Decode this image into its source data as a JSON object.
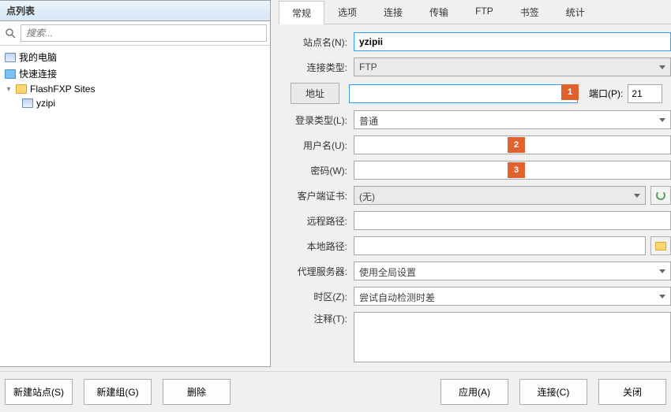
{
  "left": {
    "header": "点列表",
    "search_placeholder": "搜索...",
    "tree": {
      "my_pc": "我的电脑",
      "quick": "快速连接",
      "sites": "FlashFXP Sites",
      "site1": "yzipi"
    }
  },
  "tabs": [
    "常规",
    "选项",
    "连接",
    "传输",
    "FTP",
    "书签",
    "统计"
  ],
  "form": {
    "site_name_label": "站点名(N):",
    "site_name_value": "yzipii",
    "conn_type_label": "连接类型:",
    "conn_type_value": "FTP",
    "address_btn": "地址",
    "address_value": "",
    "port_label": "端口(P):",
    "port_value": "21",
    "login_type_label": "登录类型(L):",
    "login_type_value": "普通",
    "user_label": "用户名(U):",
    "user_value": "",
    "pass_label": "密码(W):",
    "pass_value": "",
    "cert_label": "客户端证书:",
    "cert_value": "(无)",
    "remote_label": "远程路径:",
    "remote_value": "",
    "local_label": "本地路径:",
    "local_value": "",
    "proxy_label": "代理服务器:",
    "proxy_value": "使用全局设置",
    "tz_label": "时区(Z):",
    "tz_value": "尝试自动检测时差",
    "notes_label": "注释(T):",
    "notes_value": ""
  },
  "markers": {
    "m1": "1",
    "m2": "2",
    "m3": "3"
  },
  "buttons": {
    "new_site": "新建站点(S)",
    "new_group": "新建组(G)",
    "delete": "删除",
    "apply": "应用(A)",
    "connect": "连接(C)",
    "close": "关闭"
  }
}
